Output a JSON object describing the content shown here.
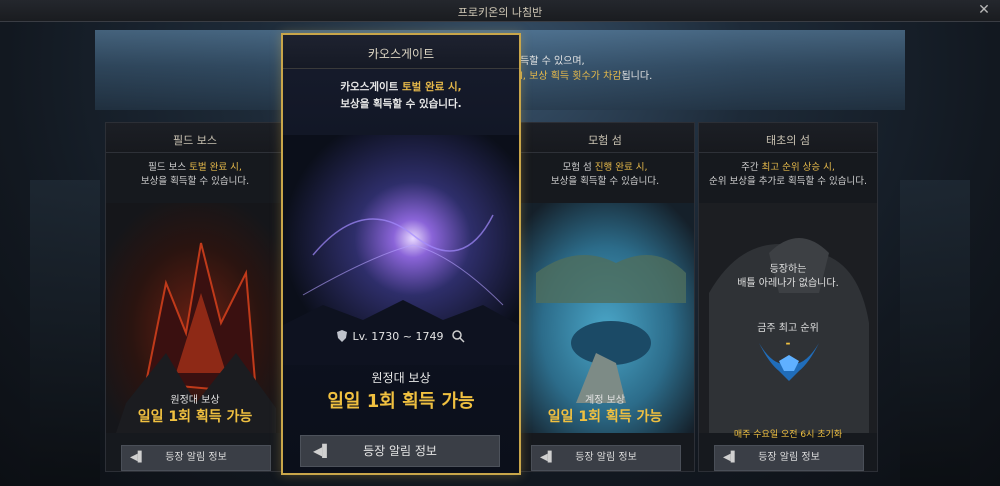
{
  "window": {
    "title": "프로키온의 나침반",
    "close_icon": "close-icon"
  },
  "banner": {
    "line1": "득할 수 있으며,",
    "line2_highlight": "l, 보상 획득 횟수가 차감",
    "line2_rest": "됩니다."
  },
  "cards": {
    "field_boss": {
      "title": "필드 보스",
      "desc_prefix": "필드 보스 ",
      "desc_highlight": "토벌 완료 시,",
      "desc_line2": "보상을 획득할 수 있습니다.",
      "reward_label": "원정대 보상",
      "reward_value": "일일 1회 획득 가능",
      "notify_label": "등장 알림 정보"
    },
    "chaos_gate": {
      "title": "카오스게이트",
      "desc_prefix": "카오스게이트 ",
      "desc_highlight": "토벌 완료 시,",
      "desc_line2": "보상을 획득할 수 있습니다.",
      "level_text": "Lv. 1730 ~ 1749",
      "reward_label": "원정대 보상",
      "reward_value": "일일 1회 획득 가능",
      "notify_label": "등장 알림 정보"
    },
    "adventure_island": {
      "title": "모험 섬",
      "desc_prefix": "모험 섬 ",
      "desc_highlight": "진행 완료 시,",
      "desc_line2": "보상을 획득할 수 있습니다.",
      "reward_label": "계정 보상",
      "reward_value": "일일 1회 획득 가능",
      "notify_label": "등장 알림 정보"
    },
    "origin_island": {
      "title": "태초의 섬",
      "desc_prefix": "주간 ",
      "desc_highlight": "최고 순위 상승 시,",
      "desc_line2": "순위 보상을 추가로 획득할 수 있습니다.",
      "battle_line1": "등장하는",
      "battle_line2": "배틀 아레나가 없습니다.",
      "rank_label": "금주 최고 순위",
      "rank_value": "-",
      "reset_text": "매주 수요일 오전 6시 초기화",
      "notify_label": "등장 알림 정보"
    }
  },
  "colors": {
    "accent_gold": "#f0c040",
    "highlight": "#e6b94a",
    "featured_border": "#c9a64a"
  }
}
